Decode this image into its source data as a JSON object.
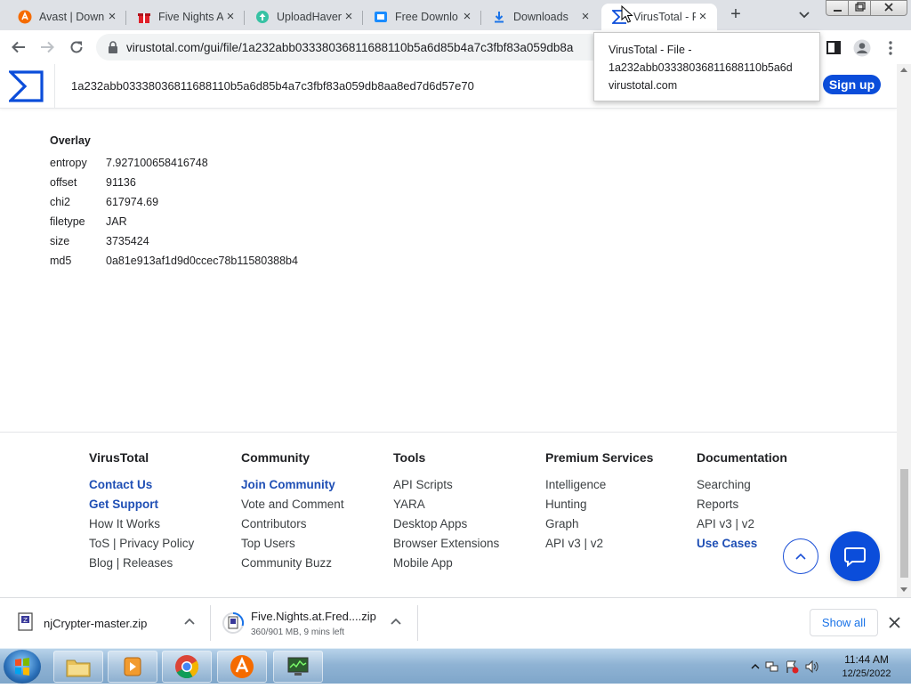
{
  "browser": {
    "tabs": [
      {
        "title": "Avast | Down",
        "icon": "avast-icon"
      },
      {
        "title": "Five Nights A",
        "icon": "gift-icon"
      },
      {
        "title": "UploadHaven",
        "icon": "uploadhaven-icon"
      },
      {
        "title": "Free Downlo",
        "icon": "download-site-icon"
      },
      {
        "title": "Downloads",
        "icon": "download-arrow-icon"
      },
      {
        "title": "VirusTotal - F",
        "icon": "virustotal-icon",
        "active": true
      }
    ],
    "url": "virustotal.com/gui/file/1a232abb03338036811688110b5a6d85b4a7c3fbf83a059db8a",
    "tooltip": {
      "line1": "VirusTotal - File -",
      "line2": "1a232abb03338036811688110b5a6d",
      "line3": "virustotal.com"
    }
  },
  "vt": {
    "hash": "1a232abb03338036811688110b5a6d85b4a7c3fbf83a059db8aa8ed7d6d57e70",
    "signup_label": "Sign up",
    "brand_color": "#0b4dda"
  },
  "overlay": {
    "title": "Overlay",
    "rows": [
      {
        "key": "entropy",
        "value": "7.927100658416748"
      },
      {
        "key": "offset",
        "value": "91136"
      },
      {
        "key": "chi2",
        "value": "617974.69"
      },
      {
        "key": "filetype",
        "value": "JAR"
      },
      {
        "key": "size",
        "value": "3735424"
      },
      {
        "key": "md5",
        "value": "0a81e913af1d9d0ccec78b11580388b4"
      }
    ]
  },
  "footer": {
    "columns": [
      {
        "heading": "VirusTotal",
        "links": [
          {
            "label": "Contact Us",
            "highlight": true
          },
          {
            "label": "Get Support",
            "highlight": true
          },
          {
            "label": "How It Works"
          },
          {
            "label": "ToS | Privacy Policy"
          },
          {
            "label": "Blog | Releases"
          }
        ]
      },
      {
        "heading": "Community",
        "links": [
          {
            "label": "Join Community",
            "highlight": true
          },
          {
            "label": "Vote and Comment"
          },
          {
            "label": "Contributors"
          },
          {
            "label": "Top Users"
          },
          {
            "label": "Community Buzz"
          }
        ]
      },
      {
        "heading": "Tools",
        "links": [
          {
            "label": "API Scripts"
          },
          {
            "label": "YARA"
          },
          {
            "label": "Desktop Apps"
          },
          {
            "label": "Browser Extensions"
          },
          {
            "label": "Mobile App"
          }
        ]
      },
      {
        "heading": "Premium Services",
        "links": [
          {
            "label": "Intelligence"
          },
          {
            "label": "Hunting"
          },
          {
            "label": "Graph"
          },
          {
            "label": "API v3 | v2"
          }
        ]
      },
      {
        "heading": "Documentation",
        "links": [
          {
            "label": "Searching"
          },
          {
            "label": "Reports"
          },
          {
            "label": "API v3 | v2"
          },
          {
            "label": "Use Cases",
            "highlight": true
          }
        ]
      }
    ]
  },
  "downloads": {
    "items": [
      {
        "name": "njCrypter-master.zip",
        "status": ""
      },
      {
        "name": "Five.Nights.at.Fred....zip",
        "status": "360/901 MB, 9 mins left"
      }
    ],
    "show_all_label": "Show all"
  },
  "taskbar": {
    "time": "11:44 AM",
    "date": "12/25/2022"
  }
}
